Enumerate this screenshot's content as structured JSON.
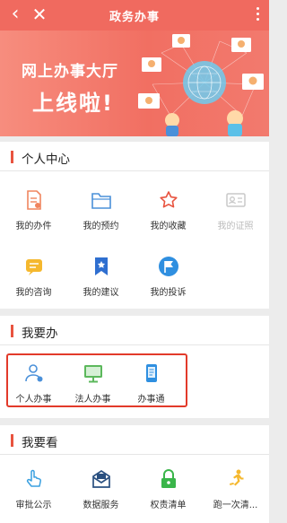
{
  "header": {
    "title": "政务办事",
    "back_icon": "back-icon",
    "close_icon": "close-icon",
    "more_icon": "more-icon",
    "bg_color": "#f06a5f"
  },
  "banner": {
    "line1": "网上办事大厅",
    "line2": "上线啦!",
    "illustration": "network-people-illustration"
  },
  "personal_center": {
    "title": "个人中心",
    "items": [
      {
        "label": "我的办件",
        "icon": "document-icon",
        "color": "#f0855f"
      },
      {
        "label": "我的预约",
        "icon": "folder-icon",
        "color": "#4a90d9"
      },
      {
        "label": "我的收藏",
        "icon": "star-icon",
        "color": "#e8533f"
      },
      {
        "label": "我的证照",
        "icon": "id-card-icon",
        "color": "#c8c8c8"
      },
      {
        "label": "我的咨询",
        "icon": "chat-icon",
        "color": "#f5b82e"
      },
      {
        "label": "我的建议",
        "icon": "bookmark-icon",
        "color": "#2f6fd0"
      },
      {
        "label": "我的投诉",
        "icon": "flag-icon",
        "color": "#2f8fe0"
      }
    ]
  },
  "handle": {
    "title": "我要办",
    "items": [
      {
        "label": "个人办事",
        "icon": "person-icon",
        "color": "#4a90d9"
      },
      {
        "label": "法人办事",
        "icon": "monitor-icon",
        "color": "#5cb85c"
      },
      {
        "label": "办事通",
        "icon": "phone-doc-icon",
        "color": "#2f8fe0"
      }
    ]
  },
  "view": {
    "title": "我要看",
    "items": [
      {
        "label": "审批公示",
        "icon": "hand-pointer-icon",
        "color": "#3aa0e0"
      },
      {
        "label": "数据服务",
        "icon": "envelope-icon",
        "color": "#2a5080"
      },
      {
        "label": "权责清单",
        "icon": "lock-icon",
        "color": "#3ab54a"
      },
      {
        "label": "跑一次清...",
        "icon": "runner-icon",
        "color": "#f5b82e"
      }
    ]
  },
  "accent_color": "#e8533f",
  "highlight_color": "#e23a2a"
}
